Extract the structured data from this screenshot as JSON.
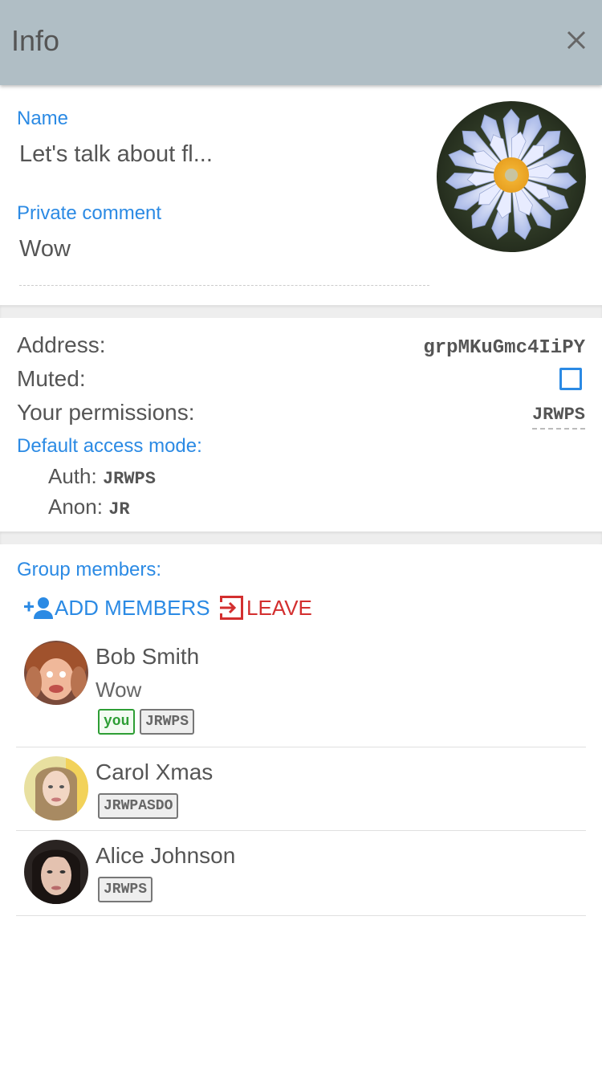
{
  "header": {
    "title": "Info"
  },
  "group": {
    "name_label": "Name",
    "name_value": "Let's talk about fl...",
    "comment_label": "Private comment",
    "comment_value": "Wow"
  },
  "details": {
    "address_label": "Address:",
    "address_value": "grpMKuGmc4IiPY",
    "muted_label": "Muted:",
    "permissions_label": "Your permissions:",
    "permissions_value": "JRWPS",
    "default_access_label": "Default access mode:",
    "auth_label": "Auth:",
    "auth_value": "JRWPS",
    "anon_label": "Anon:",
    "anon_value": "JR"
  },
  "members_section": {
    "label": "Group members:",
    "add_members": "ADD MEMBERS",
    "leave": "LEAVE"
  },
  "members": [
    {
      "name": "Bob Smith",
      "comment": "Wow",
      "badges": [
        "you",
        "JRWPS"
      ]
    },
    {
      "name": "Carol Xmas",
      "badges": [
        "JRWPASDO"
      ]
    },
    {
      "name": "Alice Johnson",
      "badges": [
        "JRWPS"
      ]
    }
  ],
  "colors": {
    "accent": "#2b8ae4",
    "danger": "#d32f2f",
    "header": "#b0bec5",
    "you_badge": "#2e9e35"
  }
}
